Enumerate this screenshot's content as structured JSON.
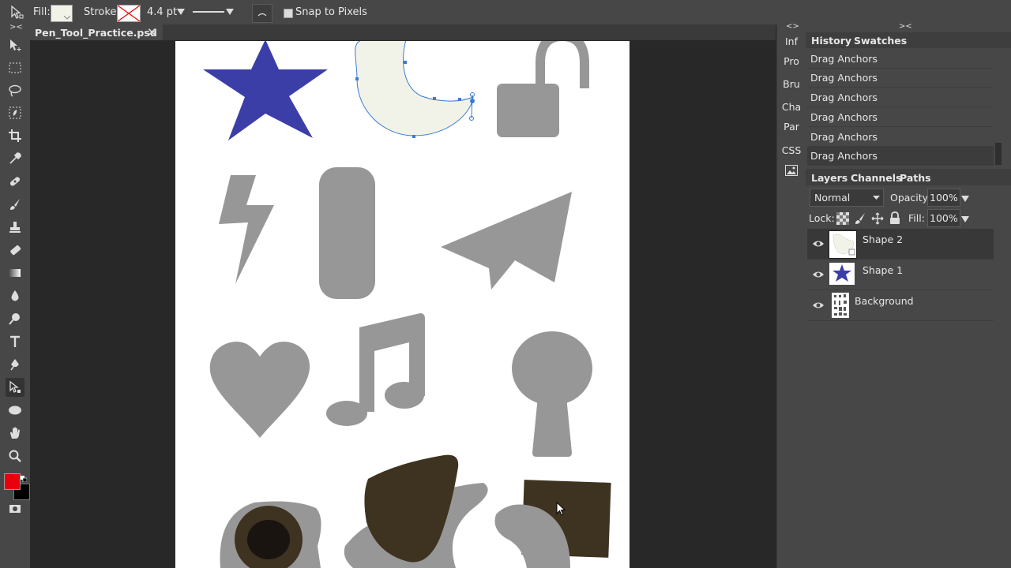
{
  "options_bar": {
    "fill_label": "Fill:",
    "stroke_label": "Stroke:",
    "stroke_width": "4.4 pt",
    "snap_label": "Snap to Pixels",
    "snap_checked": false,
    "fill_color": "#f2f3e8"
  },
  "document": {
    "tab_name": "Pen_Tool_Practice.psd",
    "close_glyph": "✕"
  },
  "tools": [
    "move-icon",
    "marquee-icon",
    "lasso-icon",
    "quick-select-icon",
    "crop-icon",
    "eyedropper-icon",
    "healing-icon",
    "brush-icon",
    "stamp-icon",
    "eraser-icon",
    "gradient-icon",
    "blur-icon",
    "dodge-icon",
    "type-icon",
    "pen-icon",
    "path-select-icon",
    "ellipse-icon",
    "hand-icon",
    "zoom-icon"
  ],
  "colors": {
    "foreground": "#e8000c",
    "background": "#000000",
    "shape_gray": "#979797",
    "star_blue": "#3c3ea8",
    "brown": "#3e3220",
    "selection_blue": "#3a7bd5"
  },
  "mini_panel": {
    "items": [
      "Inf",
      "Pro",
      "Bru",
      "Cha",
      "Par",
      "CSS"
    ],
    "collapse_left": "<>",
    "collapse_right": "><"
  },
  "history": {
    "tab_history": "History",
    "tab_swatches": "Swatches",
    "items": [
      "Drag Anchors",
      "Drag Anchors",
      "Drag Anchors",
      "Drag Anchors",
      "Drag Anchors",
      "Drag Anchors"
    ]
  },
  "layers": {
    "tab_layers": "Layers",
    "tab_channels": "Channels",
    "tab_paths": "Paths",
    "blend_mode": "Normal",
    "opacity_label": "Opacity:",
    "opacity_value": "100%",
    "lock_label": "Lock:",
    "fill_label": "Fill:",
    "fill_value": "100%",
    "items": [
      {
        "name": "Shape 2",
        "selected": true
      },
      {
        "name": "Shape 1",
        "selected": false
      },
      {
        "name": "Background",
        "selected": false
      }
    ]
  }
}
